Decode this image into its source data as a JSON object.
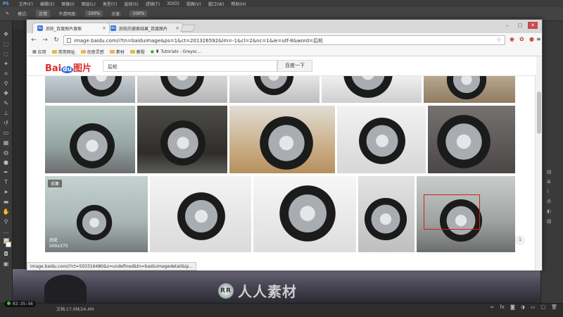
{
  "photoshop": {
    "logo": "PS",
    "menu": [
      "文件(F)",
      "编辑(E)",
      "图像(I)",
      "图层(L)",
      "类型(Y)",
      "选择(S)",
      "滤镜(T)",
      "3D(D)",
      "视图(V)",
      "窗口(W)",
      "帮助(H)"
    ],
    "options": {
      "mode_label": "模式:",
      "mode_value": "正常",
      "opacity_label": "不透明度:",
      "opacity_value": "100%",
      "flow_label": "流量:",
      "flow_value": "100%"
    },
    "doc_info": "文档:17.0M/24.4M",
    "timer": "02:35:56",
    "watermark_text": "人人素材"
  },
  "browser": {
    "tabs": [
      {
        "title": "后轮_百度图片搜索",
        "active": true
      },
      {
        "title": "后轮的搜索结果_百度图片",
        "active": false
      }
    ],
    "url": "image.baidu.com/i?tn=baiduimage&ps=1&ct=201326592&lm=-1&cl=2&nc=1&ie=utf-8&word=后轮",
    "bookmarks": [
      {
        "label": "应用",
        "icon": "apps-icon"
      },
      {
        "label": "常用网址",
        "icon": "folder-icon"
      },
      {
        "label": "创意灵感",
        "icon": "folder-icon"
      },
      {
        "label": "素材",
        "icon": "folder-icon"
      },
      {
        "label": "教程",
        "icon": "folder-icon"
      },
      {
        "label": "Tutorials - Greysc...",
        "icon": "greyscalegorilla-icon"
      }
    ],
    "status_url": "image.baidu.com/i?ct=503316480&z=undefined&tn=baiduimagedetail&ip..."
  },
  "baidu": {
    "logo_text": "Bai",
    "logo_paw": "du",
    "logo_suffix": "图片",
    "search_value": "后轮",
    "search_button": "百度一下",
    "hover_tag": "采集",
    "hover_title": "后轮",
    "hover_size": "500x375",
    "page_indicator": "1"
  },
  "colors": {
    "baidu_red": "#e02a2a",
    "baidu_blue": "#2f6ee0",
    "ps_dark": "#3a3a3a"
  }
}
